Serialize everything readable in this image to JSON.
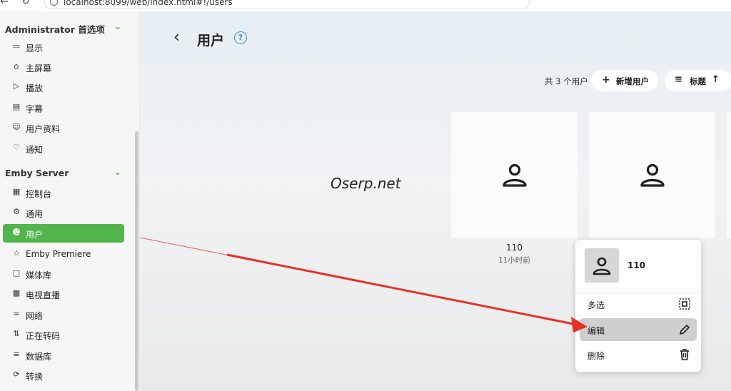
{
  "browser": {
    "url": "localhost:8099/web/index.html#!/users"
  },
  "sidebar": {
    "section1": {
      "title": "Administrator 首选项"
    },
    "section1_items": [
      {
        "label": "显示",
        "icon": "monitor-icon"
      },
      {
        "label": "主屏幕",
        "icon": "home-icon"
      },
      {
        "label": "播放",
        "icon": "play-circle-icon"
      },
      {
        "label": "字幕",
        "icon": "subtitles-icon"
      },
      {
        "label": "用户资料",
        "icon": "user-profile-icon"
      },
      {
        "label": "通知",
        "icon": "bell-icon"
      }
    ],
    "section2": {
      "title": "Emby Server"
    },
    "section2_items": [
      {
        "label": "控制台",
        "icon": "dashboard-icon"
      },
      {
        "label": "通用",
        "icon": "gear-icon"
      },
      {
        "label": "用户",
        "icon": "users-icon",
        "active": true
      },
      {
        "label": "Emby Premiere",
        "icon": "star-icon"
      },
      {
        "label": "媒体库",
        "icon": "folder-icon"
      },
      {
        "label": "电视直播",
        "icon": "tv-icon"
      },
      {
        "label": "网络",
        "icon": "wifi-icon"
      },
      {
        "label": "正在转码",
        "icon": "transcode-icon"
      },
      {
        "label": "数据库",
        "icon": "database-icon"
      },
      {
        "label": "转换",
        "icon": "convert-icon"
      }
    ],
    "accent_color": "#52b54b"
  },
  "header": {
    "title": "用户",
    "help_icon": "help-circle-icon"
  },
  "toolbar": {
    "count_text": "共 3 个用户",
    "add_user_label": "新增用户",
    "sort_label": "标题"
  },
  "watermark": "Oserp.net",
  "users": [
    {
      "name": "110",
      "last_seen": "11小时前"
    },
    {
      "name": "",
      "last_seen": ""
    }
  ],
  "context_menu": {
    "user_name": "110",
    "items": [
      {
        "label": "多选",
        "icon": "multi-select-icon"
      },
      {
        "label": "编辑",
        "icon": "pencil-icon",
        "highlighted": true
      },
      {
        "label": "删除",
        "icon": "trash-icon"
      }
    ]
  },
  "annotation_arrow_color": "#e53225"
}
